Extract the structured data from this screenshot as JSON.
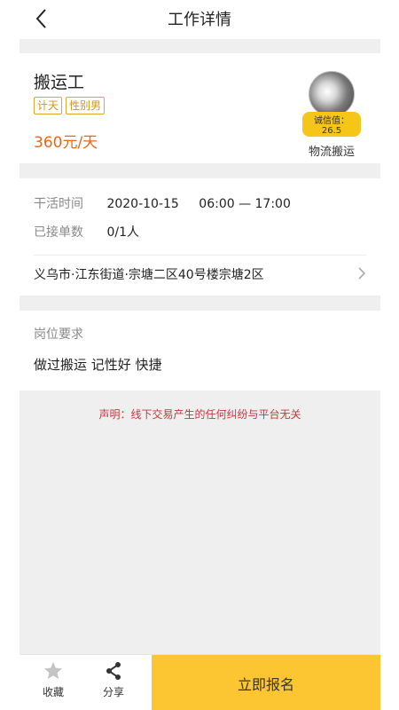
{
  "header": {
    "title": "工作详情"
  },
  "job": {
    "title": "搬运工",
    "tags": [
      "计天",
      "性别男"
    ],
    "salary": "360元/天",
    "employer": {
      "credit_badge": "诚信值：26.5",
      "name": "物流搬运"
    }
  },
  "info": {
    "work_time_label": "干活时间",
    "work_date": "2020-10-15",
    "work_time_range": "06:00 — 17:00",
    "accepted_label": "已接单数",
    "accepted_value": "0/1人",
    "address": "义乌市·江东街道·宗塘二区40号楼宗塘2区"
  },
  "requirements": {
    "label": "岗位要求",
    "text": "做过搬运 记性好 快捷"
  },
  "disclaimer": "声明：线下交易产生的任何纠纷与平台无关",
  "bottom_bar": {
    "favorite_label": "收藏",
    "share_label": "分享",
    "apply_label": "立即报名"
  },
  "colors": {
    "accent": "#fbc632",
    "salary": "#e7671a",
    "tag": "#d6951a",
    "disclaimer": "#c8373a"
  },
  "icons": [
    "back-arrow-icon",
    "chevron-right-icon",
    "star-icon",
    "share-icon"
  ]
}
